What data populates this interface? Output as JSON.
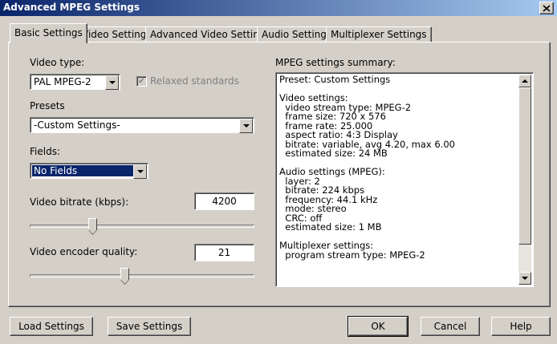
{
  "window": {
    "title": "Advanced MPEG Settings"
  },
  "tabs": [
    {
      "label": "Basic Settings",
      "active": true
    },
    {
      "label": "Video Settings",
      "active": false
    },
    {
      "label": "Advanced Video Settings",
      "active": false
    },
    {
      "label": "Audio Settings",
      "active": false
    },
    {
      "label": "Multiplexer Settings",
      "active": false
    }
  ],
  "video_type": {
    "label": "Video type:",
    "value": "PAL MPEG-2"
  },
  "relaxed": {
    "label": "Relaxed standards",
    "checked": true,
    "enabled": false
  },
  "presets": {
    "label": "Presets",
    "value": "-Custom Settings-"
  },
  "fields": {
    "label": "Fields:",
    "value": "No Fields"
  },
  "video_bitrate": {
    "label": "Video bitrate (kbps):",
    "value": "4200",
    "slider_fraction": 0.28
  },
  "encoder_quality": {
    "label": "Video encoder quality:",
    "value": "21",
    "slider_fraction": 0.42
  },
  "summary": {
    "label": "MPEG settings summary:",
    "lines": [
      "Preset: Custom Settings",
      "",
      "Video settings:",
      "  video stream type: MPEG-2",
      "  frame size: 720 x 576",
      "  frame rate: 25.000",
      "  aspect ratio: 4:3 Display",
      "  bitrate: variable, avg 4.20, max 6.00",
      "  estimated size: 24 MB",
      "",
      "Audio settings (MPEG):",
      "  layer: 2",
      "  bitrate: 224 kbps",
      "  frequency: 44.1 kHz",
      "  mode: stereo",
      "  CRC: off",
      "  estimated size: 1 MB",
      "",
      "Multiplexer settings:",
      "  program stream type: MPEG-2"
    ]
  },
  "buttons": {
    "load": "Load Settings",
    "save": "Save Settings",
    "ok": "OK",
    "cancel": "Cancel",
    "help": "Help"
  }
}
